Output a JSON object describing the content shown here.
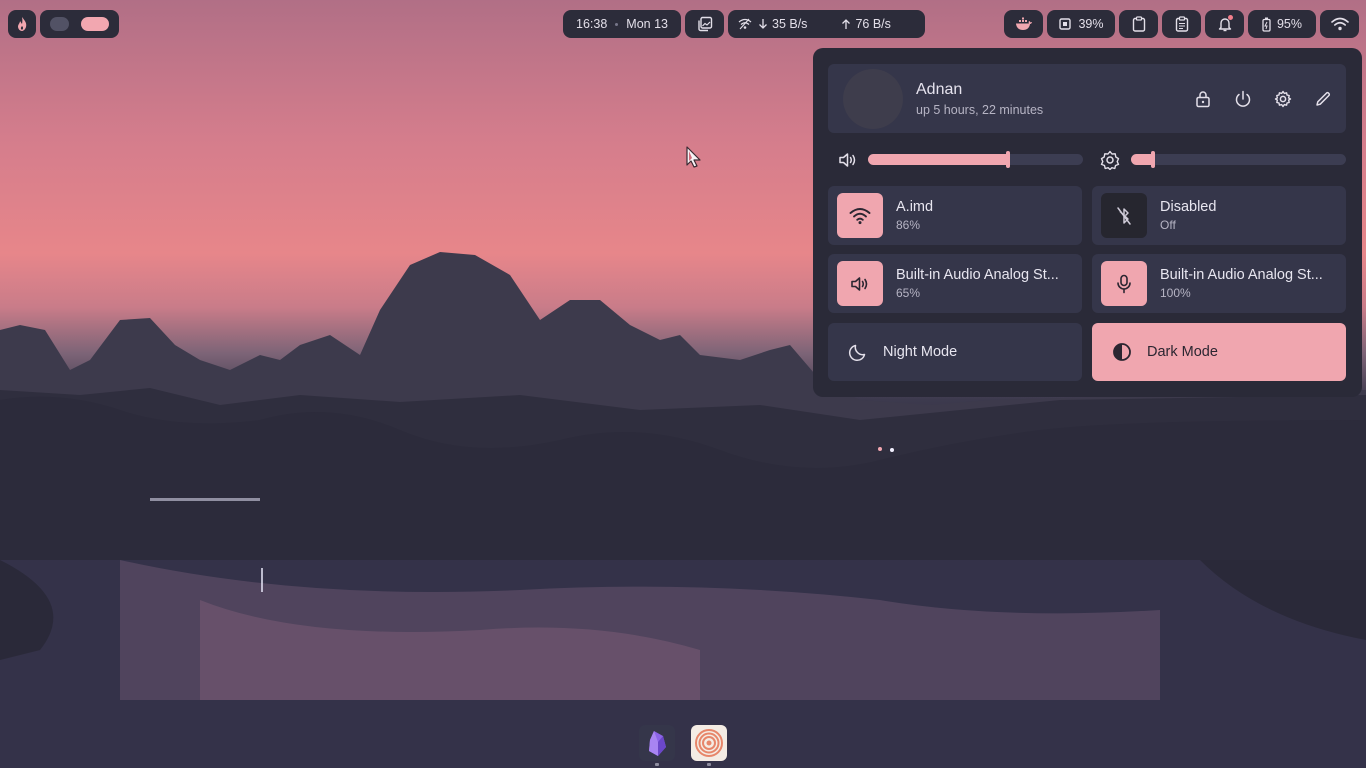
{
  "colors": {
    "accent": "#f0a6af",
    "bar_bg": "#2c2c3a",
    "panel_bg": "#2a2a38",
    "card_bg": "#35364a"
  },
  "topbar": {
    "launcher_icon": "arch-flame-icon",
    "workspaces": [
      {
        "state": "inactive"
      },
      {
        "state": "active"
      }
    ],
    "clock": {
      "time": "16:38",
      "date": "Mon 13"
    },
    "screenshot_icon": "screenshot-gallery-icon",
    "network_speed": {
      "download": "35 B/s",
      "upload": "76 B/s"
    },
    "docker_icon": "docker-whale-icon",
    "cpu": {
      "value": "39%"
    },
    "clipboard_icon": "clipboard-icon",
    "notes_icon": "notes-icon",
    "notifications_icon": "bell-icon",
    "battery": {
      "value": "95%"
    },
    "wifi_icon": "wifi-icon"
  },
  "control_center": {
    "user": {
      "name": "Adnan",
      "uptime": "up 5 hours, 22 minutes"
    },
    "actions": [
      "lock-icon",
      "power-icon",
      "settings-icon",
      "edit-icon"
    ],
    "volume": {
      "icon": "speaker-icon",
      "level": 0.65
    },
    "brightness": {
      "icon": "brightness-icon",
      "level": 0.1
    },
    "tiles": [
      {
        "id": "wifi",
        "icon": "wifi-icon",
        "title": "A.imd",
        "subtitle": "86%",
        "active": true
      },
      {
        "id": "bluetooth",
        "icon": "bluetooth-off-icon",
        "title": "Disabled",
        "subtitle": "Off",
        "active": false
      },
      {
        "id": "audio-out",
        "icon": "speaker-icon",
        "title": "Built-in Audio Analog St...",
        "subtitle": "65%",
        "active": true
      },
      {
        "id": "audio-in",
        "icon": "microphone-icon",
        "title": "Built-in Audio Analog St...",
        "subtitle": "100%",
        "active": true
      }
    ],
    "night_mode": {
      "icon": "moon-icon",
      "label": "Night Mode",
      "active": false
    },
    "dark_mode": {
      "icon": "contrast-icon",
      "label": "Dark Mode",
      "active": true
    }
  },
  "dock": {
    "apps": [
      {
        "name": "obsidian-icon"
      },
      {
        "name": "spiral-app-icon"
      }
    ]
  }
}
